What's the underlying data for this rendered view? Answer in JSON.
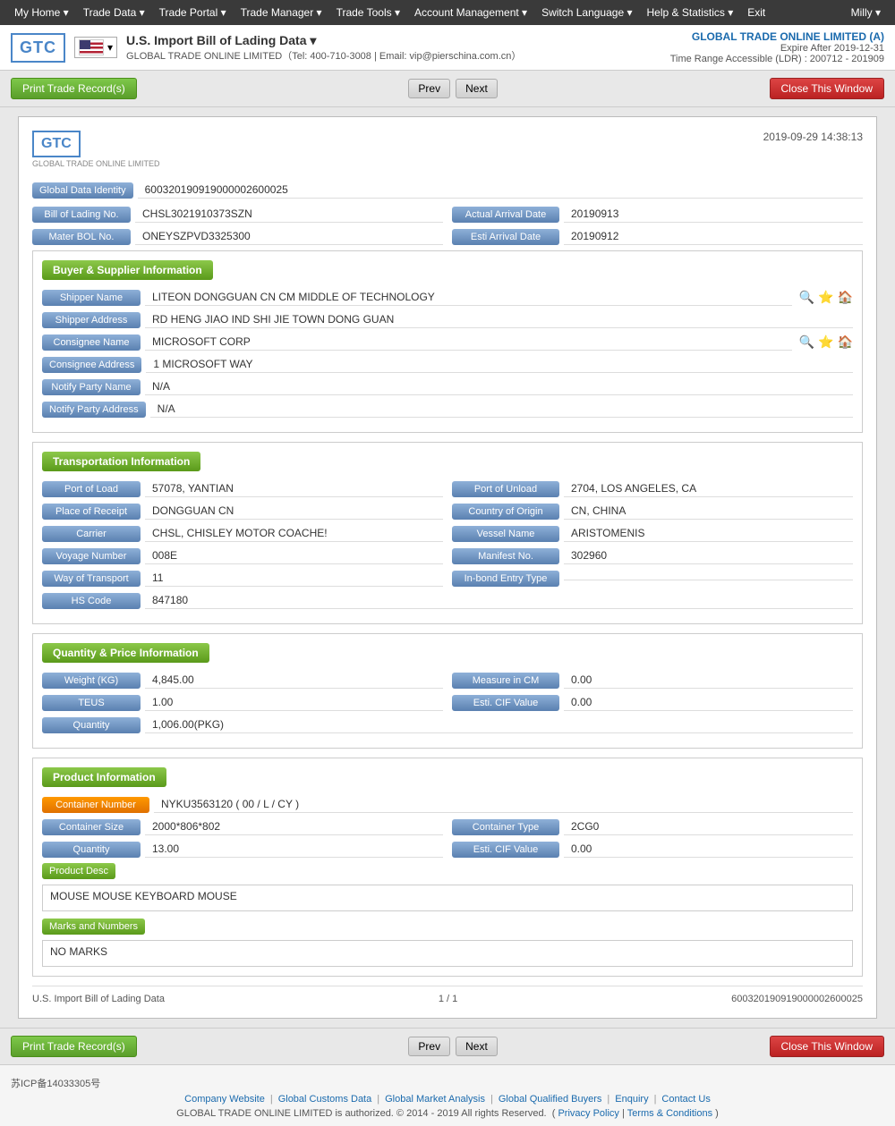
{
  "nav": {
    "items": [
      {
        "label": "My Home ▾",
        "name": "my-home"
      },
      {
        "label": "Trade Data ▾",
        "name": "trade-data"
      },
      {
        "label": "Trade Portal ▾",
        "name": "trade-portal"
      },
      {
        "label": "Trade Manager ▾",
        "name": "trade-manager"
      },
      {
        "label": "Trade Tools ▾",
        "name": "trade-tools"
      },
      {
        "label": "Account Management ▾",
        "name": "account-management"
      },
      {
        "label": "Switch Language ▾",
        "name": "switch-language"
      },
      {
        "label": "Help & Statistics ▾",
        "name": "help-statistics"
      },
      {
        "label": "Exit",
        "name": "exit"
      }
    ],
    "user": "Milly ▾"
  },
  "header": {
    "logo_text": "GTC",
    "logo_sub": "GLOBAL TRADE ONLINE LIMITED",
    "title": "U.S. Import Bill of Lading Data  ▾",
    "subtitle": "GLOBAL TRADE ONLINE LIMITED（Tel: 400-710-3008 | Email: vip@pierschina.com.cn）",
    "company_name": "GLOBAL TRADE ONLINE LIMITED (A)",
    "expire_label": "Expire After 2019-12-31",
    "time_range": "Time Range Accessible (LDR) : 200712 - 201909"
  },
  "toolbar": {
    "print_label": "Print Trade Record(s)",
    "prev_label": "Prev",
    "next_label": "Next",
    "close_label": "Close This Window"
  },
  "record": {
    "datetime": "2019-09-29 14:38:13",
    "global_data_identity_label": "Global Data Identity",
    "global_data_identity_value": "600320190919000002600025",
    "bill_of_lading_label": "Bill of Lading No.",
    "bill_of_lading_value": "CHSL3021910373SZN",
    "actual_arrival_date_label": "Actual Arrival Date",
    "actual_arrival_date_value": "20190913",
    "mater_bol_label": "Mater BOL No.",
    "mater_bol_value": "ONEYSZPVD3325300",
    "esti_arrival_label": "Esti Arrival Date",
    "esti_arrival_value": "20190912"
  },
  "buyer_supplier": {
    "section_label": "Buyer & Supplier Information",
    "shipper_name_label": "Shipper Name",
    "shipper_name_value": "LITEON DONGGUAN CN CM MIDDLE OF TECHNOLOGY",
    "shipper_address_label": "Shipper Address",
    "shipper_address_value": "RD HENG JIAO IND SHI JIE TOWN DONG GUAN",
    "consignee_name_label": "Consignee Name",
    "consignee_name_value": "MICROSOFT CORP",
    "consignee_address_label": "Consignee Address",
    "consignee_address_value": "1 MICROSOFT WAY",
    "notify_party_name_label": "Notify Party Name",
    "notify_party_name_value": "N/A",
    "notify_party_address_label": "Notify Party Address",
    "notify_party_address_value": "N/A"
  },
  "transportation": {
    "section_label": "Transportation Information",
    "port_of_load_label": "Port of Load",
    "port_of_load_value": "57078, YANTIAN",
    "port_of_unload_label": "Port of Unload",
    "port_of_unload_value": "2704, LOS ANGELES, CA",
    "place_of_receipt_label": "Place of Receipt",
    "place_of_receipt_value": "DONGGUAN CN",
    "country_of_origin_label": "Country of Origin",
    "country_of_origin_value": "CN, CHINA",
    "carrier_label": "Carrier",
    "carrier_value": "CHSL, CHISLEY MOTOR COACHE!",
    "vessel_name_label": "Vessel Name",
    "vessel_name_value": "ARISTOMENIS",
    "voyage_number_label": "Voyage Number",
    "voyage_number_value": "008E",
    "manifest_no_label": "Manifest No.",
    "manifest_no_value": "302960",
    "way_of_transport_label": "Way of Transport",
    "way_of_transport_value": "11",
    "in_bond_entry_label": "In-bond Entry Type",
    "in_bond_entry_value": "",
    "hs_code_label": "HS Code",
    "hs_code_value": "847180"
  },
  "quantity_price": {
    "section_label": "Quantity & Price Information",
    "weight_label": "Weight (KG)",
    "weight_value": "4,845.00",
    "measure_in_cm_label": "Measure in CM",
    "measure_in_cm_value": "0.00",
    "teus_label": "TEUS",
    "teus_value": "1.00",
    "esti_cif_label": "Esti. CIF Value",
    "esti_cif_value": "0.00",
    "quantity_label": "Quantity",
    "quantity_value": "1,006.00(PKG)"
  },
  "product": {
    "section_label": "Product Information",
    "container_number_label": "Container Number",
    "container_number_value": "NYKU3563120 ( 00 / L / CY )",
    "container_size_label": "Container Size",
    "container_size_value": "2000*806*802",
    "container_type_label": "Container Type",
    "container_type_value": "2CG0",
    "quantity_label": "Quantity",
    "quantity_value": "13.00",
    "esti_cif_label": "Esti. CIF Value",
    "esti_cif_value": "0.00",
    "product_desc_label": "Product Desc",
    "product_desc_value": "MOUSE MOUSE KEYBOARD MOUSE",
    "marks_label": "Marks and Numbers",
    "marks_value": "NO MARKS"
  },
  "record_footer": {
    "title": "U.S. Import Bill of Lading Data",
    "page": "1 / 1",
    "id": "600320190919000002600025"
  },
  "bottom_toolbar": {
    "print_label": "Print Trade Record(s)",
    "prev_label": "Prev",
    "next_label": "Next",
    "close_label": "Close This Window"
  },
  "footer": {
    "icp": "苏ICP备14033305号",
    "links": [
      {
        "label": "Company Website"
      },
      {
        "label": "Global Customs Data"
      },
      {
        "label": "Global Market Analysis"
      },
      {
        "label": "Global Qualified Buyers"
      },
      {
        "label": "Enquiry"
      },
      {
        "label": "Contact Us"
      }
    ],
    "copyright": "GLOBAL TRADE ONLINE LIMITED is authorized. © 2014 - 2019 All rights Reserved.",
    "privacy_label": "Privacy Policy",
    "terms_label": "Terms & Conditions"
  }
}
